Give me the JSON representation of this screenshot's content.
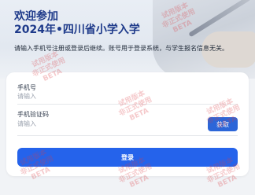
{
  "hero": {
    "title_line1": "欢迎参加",
    "title_line2": "2024年•四川省小学入学",
    "note": "请输入手机号注册或登录后继续。账号用于登录系统，与学生报名信息无关。"
  },
  "form": {
    "phone_label": "手机号",
    "phone_placeholder": "请输入",
    "code_label": "手机验证码",
    "code_placeholder": "请输入",
    "get_code_label": "获取",
    "login_label": "登录"
  },
  "watermark": {
    "line1": "试用版本",
    "line2": "非正式使用",
    "line3": "BETA"
  },
  "colors": {
    "title": "#1e3a8a",
    "primary": "#2563eb",
    "watermark": "#dc3c46"
  }
}
